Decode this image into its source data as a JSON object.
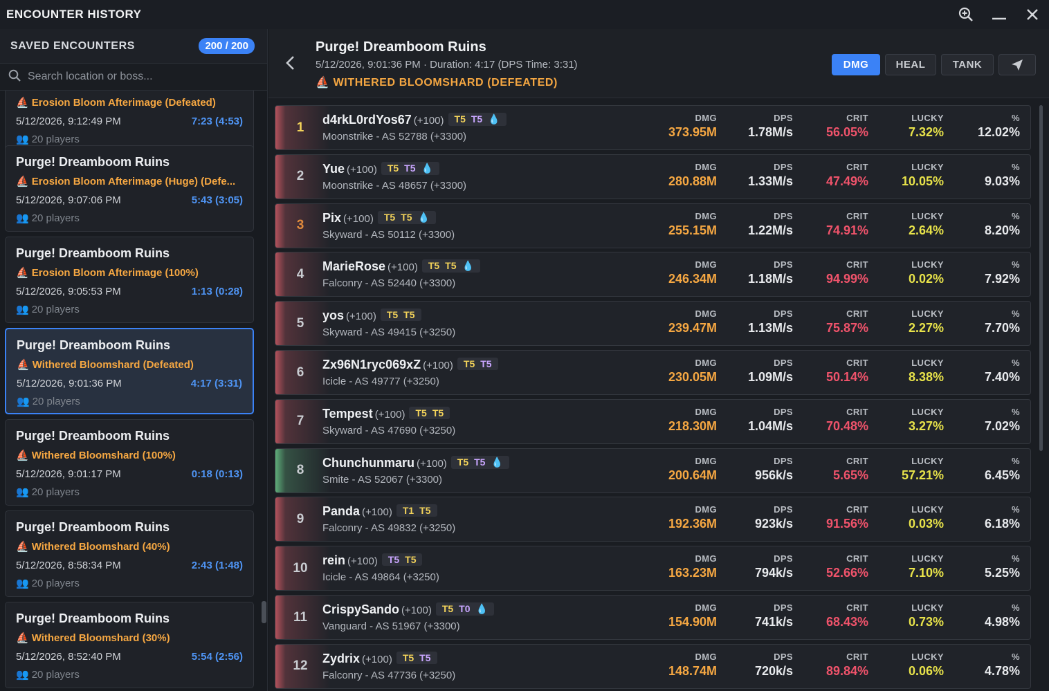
{
  "window": {
    "title": "ENCOUNTER HISTORY"
  },
  "sidebar": {
    "header": "SAVED ENCOUNTERS",
    "count": "200 / 200",
    "search_placeholder": "Search location or boss...",
    "partial": {
      "boss": "Erosion Bloom Afterimage (Defeated)",
      "time": "5/12/2026, 9:12:49 PM",
      "duration": "7:23 (4:53)",
      "players": "20 players"
    },
    "encounters": [
      {
        "name": "Purge! Dreamboom Ruins",
        "boss": "Erosion Bloom Afterimage (Huge) (Defe...",
        "time": "5/12/2026, 9:07:06 PM",
        "duration": "5:43 (3:05)",
        "players": "20 players"
      },
      {
        "name": "Purge! Dreamboom Ruins",
        "boss": "Erosion Bloom Afterimage (100%)",
        "time": "5/12/2026, 9:05:53 PM",
        "duration": "1:13 (0:28)",
        "players": "20 players"
      },
      {
        "name": "Purge! Dreamboom Ruins",
        "boss": "Withered Bloomshard (Defeated)",
        "time": "5/12/2026, 9:01:36 PM",
        "duration": "4:17 (3:31)",
        "players": "20 players"
      },
      {
        "name": "Purge! Dreamboom Ruins",
        "boss": "Withered Bloomshard (100%)",
        "time": "5/12/2026, 9:01:17 PM",
        "duration": "0:18 (0:13)",
        "players": "20 players"
      },
      {
        "name": "Purge! Dreamboom Ruins",
        "boss": "Withered Bloomshard (40%)",
        "time": "5/12/2026, 8:58:34 PM",
        "duration": "2:43 (1:48)",
        "players": "20 players"
      },
      {
        "name": "Purge! Dreamboom Ruins",
        "boss": "Withered Bloomshard (30%)",
        "time": "5/12/2026, 8:52:40 PM",
        "duration": "5:54 (2:56)",
        "players": "20 players"
      }
    ],
    "selected_index": 2
  },
  "main": {
    "title": "Purge! Dreamboom Ruins",
    "meta": "5/12/2026, 9:01:36 PM · Duration: 4:17 (DPS Time: 3:31)",
    "boss": "WITHERED BLOOMSHARD (DEFEATED)",
    "tabs": [
      "DMG",
      "HEAL",
      "TANK"
    ],
    "active_tab": "DMG",
    "column_headers": {
      "dmg": "DMG",
      "dps": "DPS",
      "crit": "CRIT",
      "lucky": "LUCKY",
      "pct": "%"
    },
    "players": [
      {
        "rank": "1",
        "name": "d4rkL0rdYos67",
        "plus": "(+100)",
        "tiers": [
          "T5",
          "T5"
        ],
        "tier_colors": [
          "y",
          "p"
        ],
        "drop": true,
        "sub": "Moonstrike - AS 52788 (+3300)",
        "dmg": "373.95M",
        "dps": "1.78M/s",
        "crit": "56.05%",
        "lucky": "7.32%",
        "pct": "12.02%",
        "accent": "#b5525c",
        "rank_color": "#f3d35a"
      },
      {
        "rank": "2",
        "name": "Yue",
        "plus": "(+100)",
        "tiers": [
          "T5",
          "T5"
        ],
        "tier_colors": [
          "y",
          "p"
        ],
        "drop": true,
        "sub": "Moonstrike - AS 48657 (+3300)",
        "dmg": "280.88M",
        "dps": "1.33M/s",
        "crit": "47.49%",
        "lucky": "10.05%",
        "pct": "9.03%",
        "accent": "#b5525c",
        "rank_color": "#c9ccd1"
      },
      {
        "rank": "3",
        "name": "Pix",
        "plus": "(+100)",
        "tiers": [
          "T5",
          "T5"
        ],
        "tier_colors": [
          "y",
          "y"
        ],
        "drop": true,
        "sub": "Skyward - AS 50112 (+3300)",
        "dmg": "255.15M",
        "dps": "1.22M/s",
        "crit": "74.91%",
        "lucky": "2.64%",
        "pct": "8.20%",
        "accent": "#b5525c",
        "rank_color": "#e08a3c"
      },
      {
        "rank": "4",
        "name": "MarieRose",
        "plus": "(+100)",
        "tiers": [
          "T5",
          "T5"
        ],
        "tier_colors": [
          "y",
          "y"
        ],
        "drop": true,
        "sub": "Falconry - AS 52440 (+3300)",
        "dmg": "246.34M",
        "dps": "1.18M/s",
        "crit": "94.99%",
        "lucky": "0.02%",
        "pct": "7.92%",
        "accent": "#b5525c",
        "rank_color": "#c9ccd1"
      },
      {
        "rank": "5",
        "name": "yos",
        "plus": "(+100)",
        "tiers": [
          "T5",
          "T5"
        ],
        "tier_colors": [
          "y",
          "y"
        ],
        "drop": false,
        "sub": "Skyward - AS 49415 (+3250)",
        "dmg": "239.47M",
        "dps": "1.13M/s",
        "crit": "75.87%",
        "lucky": "2.27%",
        "pct": "7.70%",
        "accent": "#b5525c",
        "rank_color": "#c9ccd1"
      },
      {
        "rank": "6",
        "name": "Zx96N1ryc069xZ",
        "plus": "(+100)",
        "tiers": [
          "T5",
          "T5"
        ],
        "tier_colors": [
          "y",
          "p"
        ],
        "drop": false,
        "sub": "Icicle - AS 49777 (+3250)",
        "dmg": "230.05M",
        "dps": "1.09M/s",
        "crit": "50.14%",
        "lucky": "8.38%",
        "pct": "7.40%",
        "accent": "#b5525c",
        "rank_color": "#c9ccd1"
      },
      {
        "rank": "7",
        "name": "Tempest",
        "plus": "(+100)",
        "tiers": [
          "T5",
          "T5"
        ],
        "tier_colors": [
          "y",
          "y"
        ],
        "drop": false,
        "sub": "Skyward - AS 47690 (+3250)",
        "dmg": "218.30M",
        "dps": "1.04M/s",
        "crit": "70.48%",
        "lucky": "3.27%",
        "pct": "7.02%",
        "accent": "#b5525c",
        "rank_color": "#c9ccd1"
      },
      {
        "rank": "8",
        "name": "Chunchunmaru",
        "plus": "(+100)",
        "tiers": [
          "T5",
          "T5"
        ],
        "tier_colors": [
          "y",
          "p"
        ],
        "drop": true,
        "sub": "Smite - AS 52067 (+3300)",
        "dmg": "200.64M",
        "dps": "956k/s",
        "crit": "5.65%",
        "lucky": "57.21%",
        "pct": "6.45%",
        "accent": "#5fae7a",
        "rank_color": "#c9ccd1"
      },
      {
        "rank": "9",
        "name": "Panda",
        "plus": "(+100)",
        "tiers": [
          "T1",
          "T5"
        ],
        "tier_colors": [
          "y",
          "y"
        ],
        "drop": false,
        "sub": "Falconry - AS 49832 (+3250)",
        "dmg": "192.36M",
        "dps": "923k/s",
        "crit": "91.56%",
        "lucky": "0.03%",
        "pct": "6.18%",
        "accent": "#b5525c",
        "rank_color": "#c9ccd1"
      },
      {
        "rank": "10",
        "name": "rein",
        "plus": "(+100)",
        "tiers": [
          "T5",
          "T5"
        ],
        "tier_colors": [
          "p",
          "y"
        ],
        "drop": false,
        "sub": "Icicle - AS 49864 (+3250)",
        "dmg": "163.23M",
        "dps": "794k/s",
        "crit": "52.66%",
        "lucky": "7.10%",
        "pct": "5.25%",
        "accent": "#b5525c",
        "rank_color": "#c9ccd1"
      },
      {
        "rank": "11",
        "name": "CrispySando",
        "plus": "(+100)",
        "tiers": [
          "T5",
          "T0"
        ],
        "tier_colors": [
          "y",
          "p"
        ],
        "drop": true,
        "sub": "Vanguard - AS 51967 (+3300)",
        "dmg": "154.90M",
        "dps": "741k/s",
        "crit": "68.43%",
        "lucky": "0.73%",
        "pct": "4.98%",
        "accent": "#b5525c",
        "rank_color": "#c9ccd1"
      },
      {
        "rank": "12",
        "name": "Zydrix",
        "plus": "(+100)",
        "tiers": [
          "T5",
          "T5"
        ],
        "tier_colors": [
          "y",
          "p"
        ],
        "drop": false,
        "sub": "Falconry - AS 47736 (+3250)",
        "dmg": "148.74M",
        "dps": "720k/s",
        "crit": "89.84%",
        "lucky": "0.06%",
        "pct": "4.78%",
        "accent": "#b5525c",
        "rank_color": "#c9ccd1"
      }
    ]
  },
  "colors": {
    "accent_blue": "#3b82f6",
    "boss_orange": "#f5a742",
    "crit_red": "#f0536b",
    "lucky_yellow": "#e8e34a"
  },
  "icons": {
    "zoom": "zoom-in-icon",
    "minimize": "minimize-icon",
    "close": "close-icon",
    "search": "search-icon",
    "back": "chevron-left-icon",
    "share": "send-icon",
    "boss": "boss-icon",
    "players": "players-icon",
    "drop": "droplet-icon"
  }
}
